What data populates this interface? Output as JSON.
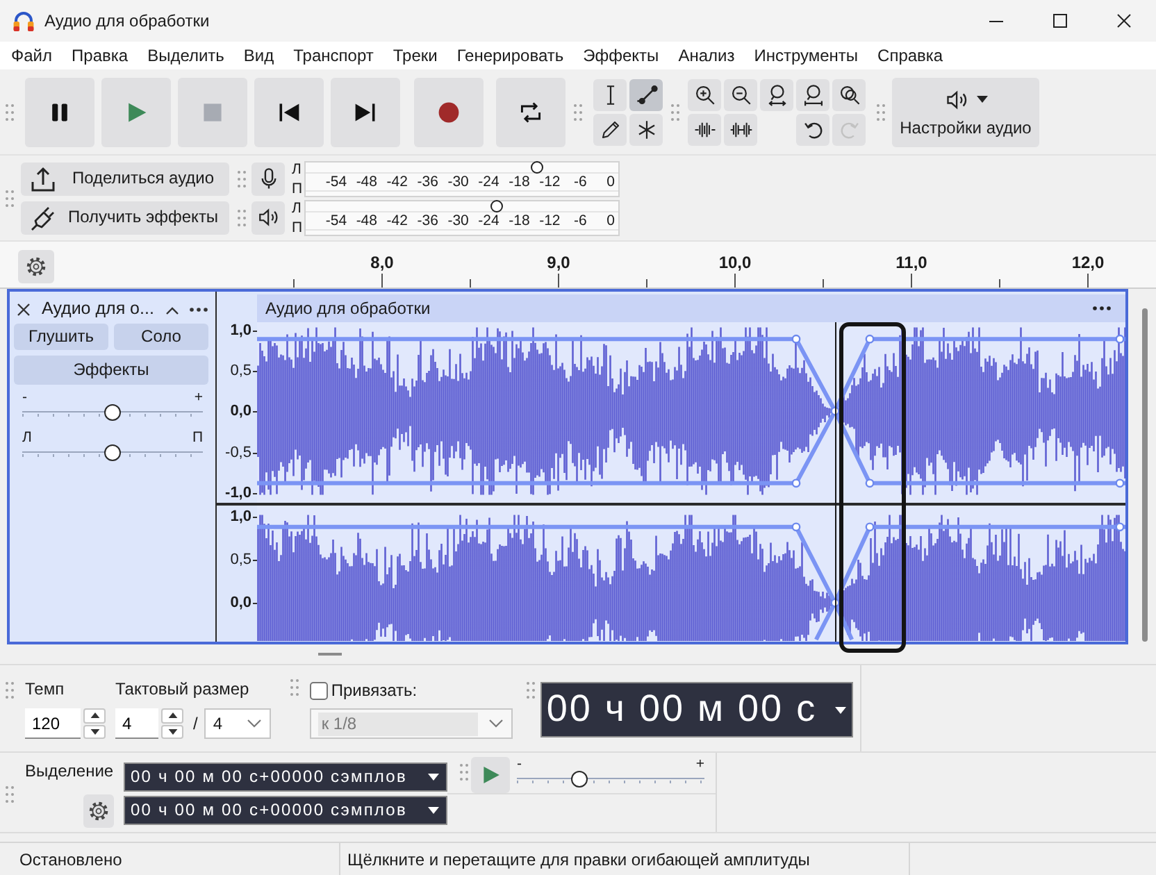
{
  "window": {
    "title": "Аудио для обработки"
  },
  "menu": [
    "Файл",
    "Правка",
    "Выделить",
    "Вид",
    "Транспорт",
    "Треки",
    "Генерировать",
    "Эффекты",
    "Анализ",
    "Инструменты",
    "Справка"
  ],
  "transport": [
    {
      "kind": "pause",
      "disabled": false
    },
    {
      "kind": "play",
      "disabled": false
    },
    {
      "kind": "stop",
      "disabled": true
    },
    {
      "kind": "skip-start",
      "disabled": false
    },
    {
      "kind": "skip-end",
      "disabled": false
    },
    {
      "kind": "record",
      "disabled": false
    },
    {
      "kind": "loop",
      "disabled": false
    }
  ],
  "tools": [
    {
      "kind": "select",
      "selected": false
    },
    {
      "kind": "envelope",
      "selected": true
    },
    {
      "kind": "draw",
      "selected": false
    },
    {
      "kind": "multi",
      "selected": false
    }
  ],
  "zoom_tools": [
    {
      "kind": "zoom-in",
      "disabled": false
    },
    {
      "kind": "zoom-out",
      "disabled": false
    },
    {
      "kind": "fit-selection",
      "disabled": false
    },
    {
      "kind": "fit-project",
      "disabled": false
    },
    {
      "kind": "zoom-toggle",
      "disabled": false
    },
    {
      "kind": "trim",
      "disabled": false
    },
    {
      "kind": "silence",
      "disabled": false
    },
    {
      "kind": "undo",
      "disabled": false
    },
    {
      "kind": "redo",
      "disabled": true
    }
  ],
  "audio_setup": {
    "label": "Настройки аудио"
  },
  "cloud_buttons": [
    {
      "kind": "share",
      "label": "Поделиться аудио"
    },
    {
      "kind": "effects",
      "label": "Получить эффекты"
    }
  ],
  "meters": [
    {
      "kind": "record",
      "channel_labels": [
        "Л",
        "П"
      ],
      "ticks": [
        "-54",
        "-48",
        "-42",
        "-36",
        "-30",
        "-24",
        "-18",
        "-12",
        "-6",
        "0"
      ],
      "level": 0.74
    },
    {
      "kind": "playback",
      "channel_labels": [
        "Л",
        "П"
      ],
      "ticks": [
        "-54",
        "-48",
        "-42",
        "-36",
        "-30",
        "-24",
        "-18",
        "-12",
        "-6",
        "0"
      ],
      "level": 0.61
    }
  ],
  "timeline": {
    "labels": [
      "8,0",
      "9,0",
      "10,0",
      "11,0",
      "12,0"
    ]
  },
  "track": {
    "name": "Аудио для о...",
    "buttons": [
      "Глушить",
      "Соло"
    ],
    "effects": "Эффекты",
    "gain": {
      "min": "-",
      "max": "+",
      "level": 0.5
    },
    "pan": {
      "min": "Л",
      "max": "П",
      "level": 0.5
    },
    "clip_title": "Аудио для обработки",
    "channels": [
      {
        "scale": [
          "1,0",
          "0,5",
          "0,0",
          "-0,5",
          "-1,0"
        ]
      },
      {
        "scale": [
          "1,0",
          "0,5",
          "0,0"
        ]
      }
    ]
  },
  "tempo": {
    "label": "Темп",
    "value": "120"
  },
  "time_signature": {
    "label": "Тактовый размер",
    "upper": "4",
    "separator": "/",
    "lower": "4"
  },
  "snap": {
    "label": "Привязать:",
    "checked": false,
    "value": "к 1/8",
    "disabled": true
  },
  "time": {
    "value": "00 ч 00 м 00 с"
  },
  "selection": {
    "label": "Выделение",
    "fields": [
      "00 ч 00 м 00 с+00000 сэмплов",
      "00 ч 00 м 00 с+00000 сэмплов"
    ]
  },
  "play_at_speed": {
    "min": "-",
    "max": "+",
    "level": 0.33
  },
  "status_bar": [
    "Остановлено",
    "Щёлкните и перетащите для правки огибающей амплитуды"
  ]
}
